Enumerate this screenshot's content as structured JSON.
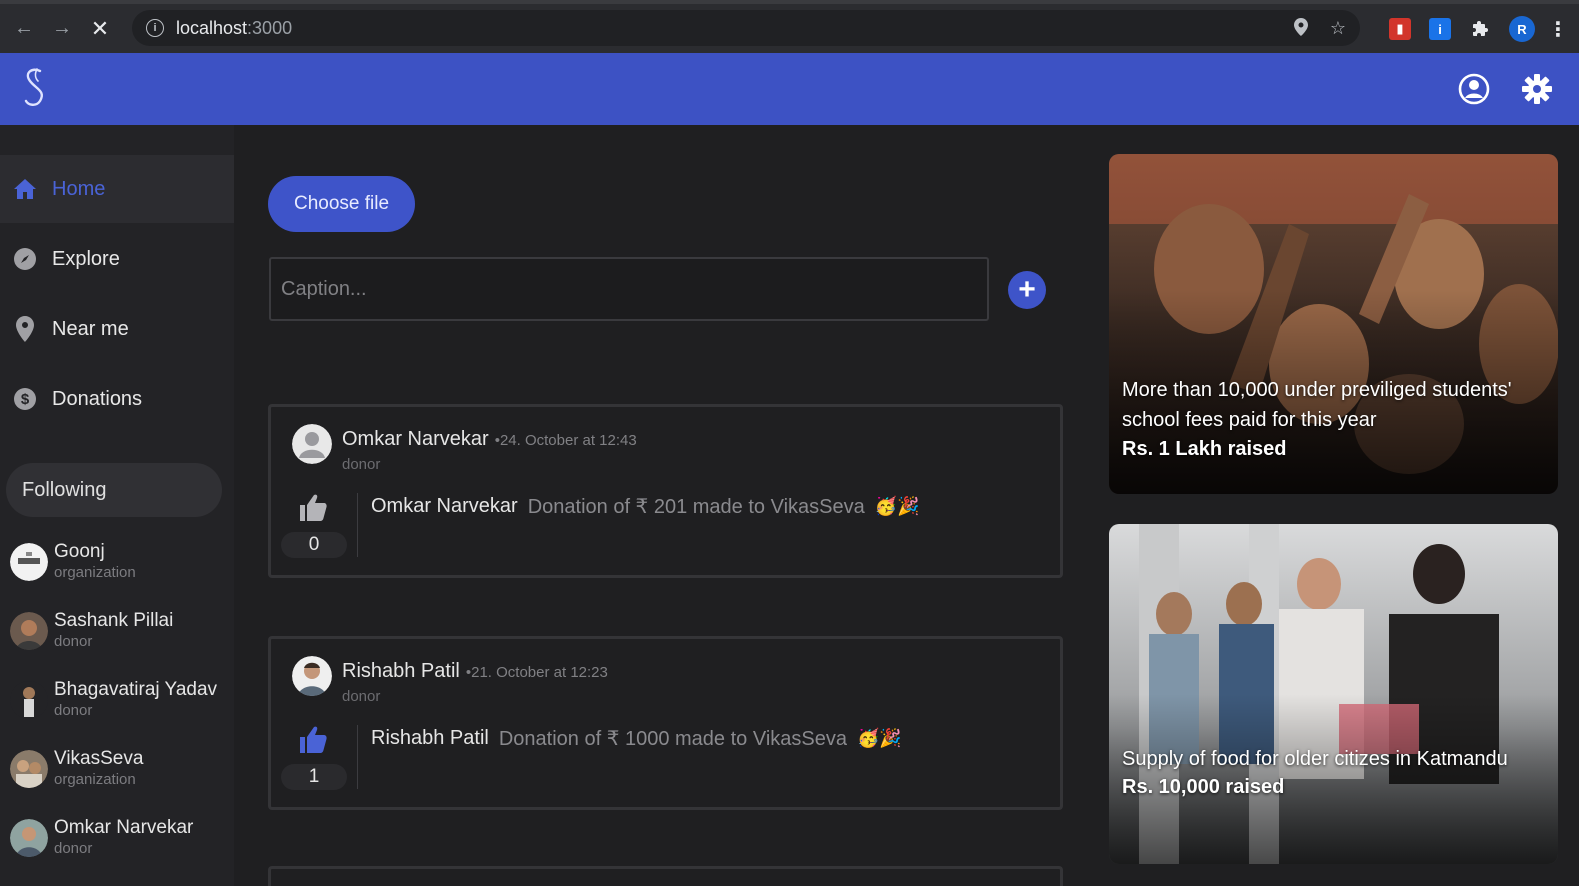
{
  "browser": {
    "url_host": "localhost",
    "url_port": ":3000",
    "profile_initial": "R"
  },
  "header": {
    "logo": "S-logo",
    "account_icon": "account-circle-icon",
    "settings_icon": "gear-icon"
  },
  "sidebar": {
    "items": [
      {
        "label": "Home",
        "icon": "home-icon",
        "active": true
      },
      {
        "label": "Explore",
        "icon": "compass-icon",
        "active": false
      },
      {
        "label": "Near me",
        "icon": "location-pin-icon",
        "active": false
      },
      {
        "label": "Donations",
        "icon": "dollar-icon",
        "active": false
      }
    ],
    "following_label": "Following",
    "following": [
      {
        "name": "Goonj",
        "role": "organization"
      },
      {
        "name": "Sashank Pillai",
        "role": "donor"
      },
      {
        "name": "Bhagavatiraj Yadav",
        "role": "donor"
      },
      {
        "name": "VikasSeva",
        "role": "organization"
      },
      {
        "name": "Omkar Narvekar",
        "role": "donor"
      }
    ]
  },
  "composer": {
    "choose_file_label": "Choose file",
    "caption_placeholder": "Caption..."
  },
  "posts": [
    {
      "author": "Omkar Narvekar",
      "time": "•24. October at 12:43",
      "role": "donor",
      "likes": "0",
      "liked": false,
      "body_name": "Omkar Narvekar",
      "body_text": "Donation of ₹ 201 made to VikasSeva",
      "emoji": "🥳🎉"
    },
    {
      "author": "Rishabh Patil",
      "time": "•21. October at 12:23",
      "role": "donor",
      "likes": "1",
      "liked": true,
      "body_name": "Rishabh Patil",
      "body_text": "Donation of ₹ 1000 made to VikasSeva",
      "emoji": "🥳🎉"
    }
  ],
  "campaigns": [
    {
      "title": "More than 10,000 under previliged students' school fees paid for this year",
      "raised": "Rs. 1 Lakh raised"
    },
    {
      "title": "Supply of food for older citizes in Katmandu",
      "raised": "Rs. 10,000 raised"
    }
  ],
  "colors": {
    "accent": "#3d52c4",
    "active_text": "#4a63d6",
    "background": "#1f1f21"
  }
}
